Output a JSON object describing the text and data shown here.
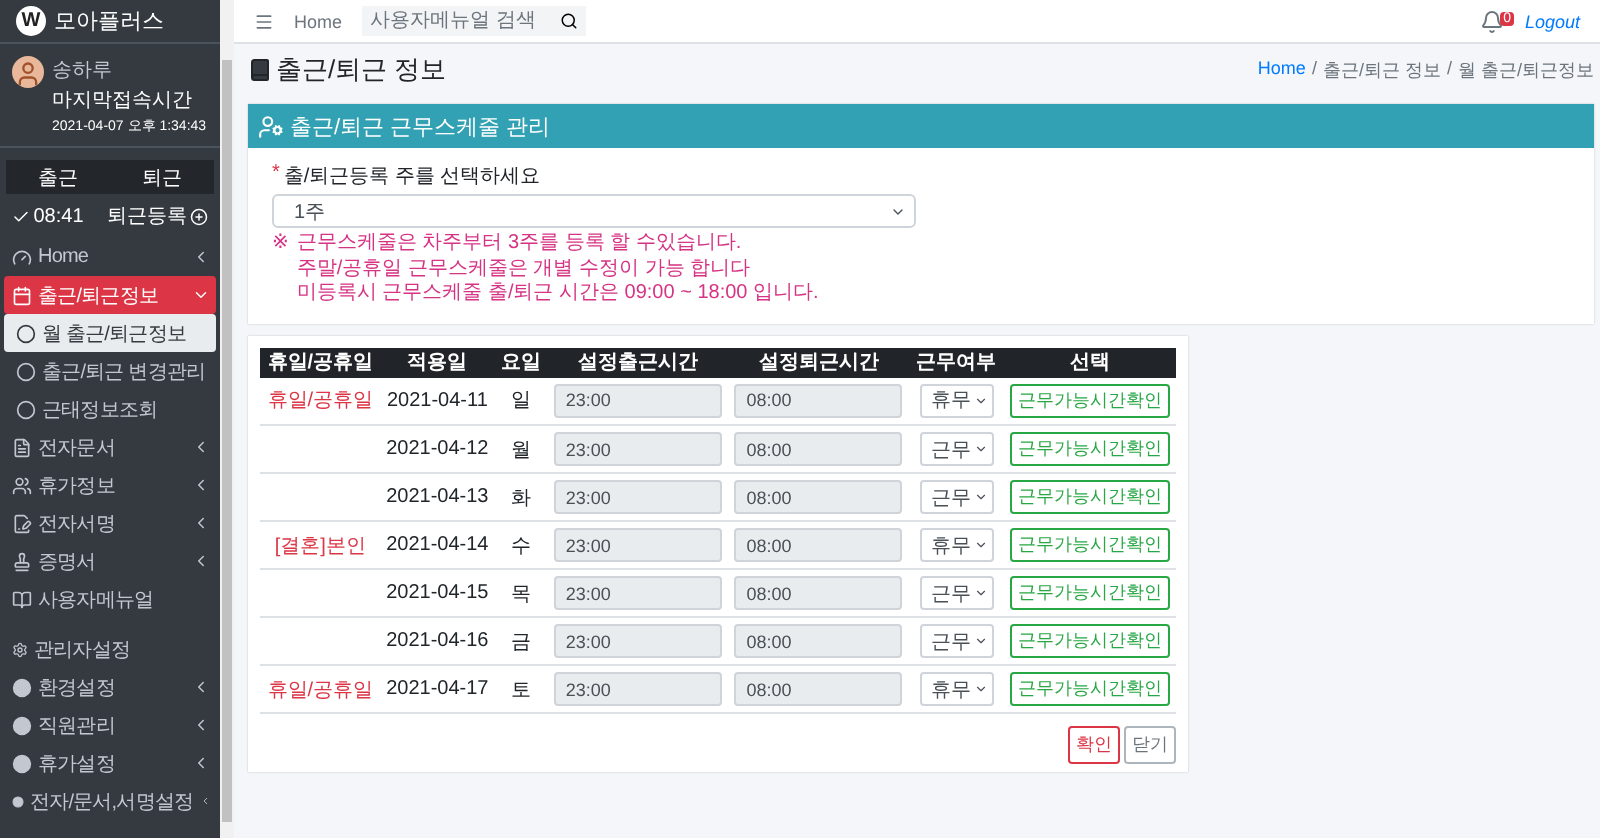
{
  "sidebar": {
    "logo": {
      "mark": "W",
      "name": "모아플러스"
    },
    "profile": {
      "name": "송하루",
      "label": "마지막접속시간",
      "time": "2021-04-07 오후 1:34:43"
    },
    "clock": {
      "buttons": [
        "출근",
        "퇴근"
      ],
      "check_in": "08:41",
      "check_out": "퇴근등록"
    },
    "items": [
      {
        "label": "Home",
        "kind": "group",
        "expanded": false,
        "selected": false
      },
      {
        "label": "출근/퇴근정보",
        "kind": "group",
        "expanded": true,
        "selected": true
      },
      {
        "label": "월 출근/퇴근정보",
        "kind": "sub",
        "selected": true
      },
      {
        "label": "출근/퇴근 변경관리",
        "kind": "sub",
        "selected": false
      },
      {
        "label": "근태정보조회",
        "kind": "sub",
        "selected": false
      },
      {
        "label": "전자문서",
        "kind": "group",
        "expanded": false,
        "selected": false
      },
      {
        "label": "휴가정보",
        "kind": "group",
        "expanded": false,
        "selected": false
      },
      {
        "label": "전자서명",
        "kind": "group",
        "expanded": false,
        "selected": false
      },
      {
        "label": "증명서",
        "kind": "group",
        "expanded": false,
        "selected": false
      },
      {
        "label": "사용자메뉴얼",
        "kind": "link",
        "selected": false
      },
      {
        "label": "관리자설정",
        "kind": "heading"
      },
      {
        "label": "환경설정",
        "kind": "admin",
        "expanded": false,
        "selected": false
      },
      {
        "label": "직원관리",
        "kind": "admin",
        "expanded": false,
        "selected": false
      },
      {
        "label": "휴가설정",
        "kind": "admin",
        "expanded": false,
        "selected": false
      },
      {
        "label": "전자/문서,서명설정",
        "kind": "admin",
        "expanded": false,
        "selected": false
      }
    ]
  },
  "topbar": {
    "home": "Home",
    "search": {
      "placeholder": "사용자메뉴얼 검색"
    },
    "notifications": "0",
    "logout": "Logout"
  },
  "page": {
    "title": "출근/퇴근 정보",
    "breadcrumb": [
      "Home",
      "출근/퇴근 정보",
      "월 출근/퇴근정보"
    ],
    "separator": "/"
  },
  "card": {
    "title": "출근/퇴근 근무스케줄 관리",
    "form": {
      "required_mark": "*",
      "label": "출/퇴근등록 주를 선택하세요",
      "value": "1주"
    },
    "note_mark": "※",
    "notes": [
      "근무스케줄은 차주부터 3주를 등록 할 수있습니다.",
      "주말/공휴일 근무스케줄은 개별 수정이 가능 합니다",
      "미등록시 근무스케줄 출/퇴근 시간은 09:00 ~ 18:00 입니다."
    ]
  },
  "table": {
    "columns": [
      "휴일/공휴일",
      "적용일",
      "요일",
      "설정출근시간",
      "설정퇴근시간",
      "근무여부",
      "선택"
    ],
    "rows": [
      {
        "holiday": "휴일/공휴일",
        "date": "2021-04-11",
        "day": "일",
        "start": "23:00",
        "end": "08:00",
        "work": "휴무",
        "action": "근무가능시간확인"
      },
      {
        "date": "2021-04-12",
        "day": "월",
        "start": "23:00",
        "end": "08:00",
        "work": "근무",
        "action": "근무가능시간확인"
      },
      {
        "date": "2021-04-13",
        "day": "화",
        "start": "23:00",
        "end": "08:00",
        "work": "근무",
        "action": "근무가능시간확인"
      },
      {
        "holiday": "[결혼]본인",
        "date": "2021-04-14",
        "day": "수",
        "start": "23:00",
        "end": "08:00",
        "work": "휴무",
        "action": "근무가능시간확인"
      },
      {
        "date": "2021-04-15",
        "day": "목",
        "start": "23:00",
        "end": "08:00",
        "work": "근무",
        "action": "근무가능시간확인"
      },
      {
        "date": "2021-04-16",
        "day": "금",
        "start": "23:00",
        "end": "08:00",
        "work": "근무",
        "action": "근무가능시간확인"
      },
      {
        "holiday": "휴일/공휴일",
        "date": "2021-04-17",
        "day": "토",
        "start": "23:00",
        "end": "08:00",
        "work": "휴무",
        "action": "근무가능시간확인"
      }
    ]
  },
  "buttons": [
    {
      "label": "확인",
      "kind": "primary"
    },
    {
      "label": "닫기",
      "kind": "secondary"
    }
  ]
}
